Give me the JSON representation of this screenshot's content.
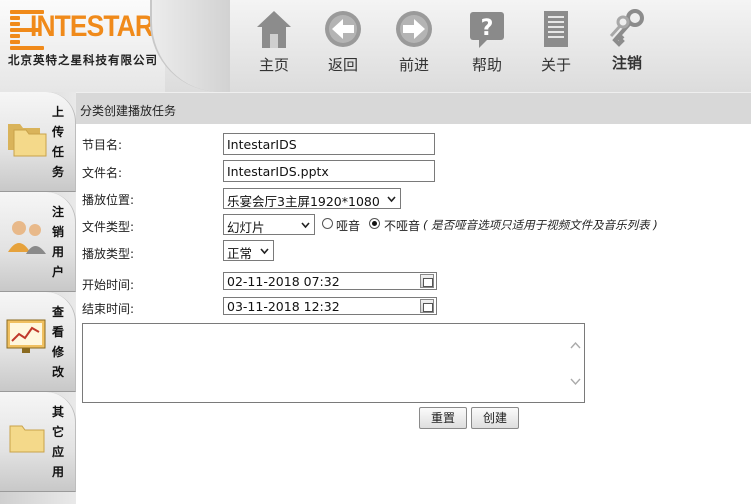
{
  "header": {
    "logo_text": "INTESTAR",
    "logo_subtitle": "北京英特之星科技有限公司",
    "nav": [
      {
        "label": "主页",
        "icon": "home-icon"
      },
      {
        "label": "返回",
        "icon": "back-arrow-icon"
      },
      {
        "label": "前进",
        "icon": "forward-arrow-icon"
      },
      {
        "label": "帮助",
        "icon": "help-icon"
      },
      {
        "label": "关于",
        "icon": "document-icon"
      },
      {
        "label": "注销",
        "icon": "keys-icon"
      }
    ]
  },
  "sidebar": {
    "items": [
      {
        "label": "上传任务",
        "icon": "folders-icon"
      },
      {
        "label": "注销用户",
        "icon": "users-icon"
      },
      {
        "label": "查看修改",
        "icon": "monitor-chart-icon"
      },
      {
        "label": "其它应用",
        "icon": "folder-icon"
      }
    ]
  },
  "breadcrumb": "分类创建播放任务",
  "form": {
    "program_name_label": "节目名:",
    "program_name_value": "IntestarIDS",
    "file_name_label": "文件名:",
    "file_name_value": "IntestarIDS.pptx",
    "location_label": "播放位置:",
    "location_value": "乐宴会厅3主屏1920*1080",
    "file_type_label": "文件类型:",
    "file_type_value": "幻灯片",
    "mute_option": "哑音",
    "unmute_option": "不哑音",
    "mute_selected": "不哑音",
    "mute_note": "( 是否哑音选项只适用于视频文件及音乐列表 )",
    "play_type_label": "播放类型:",
    "play_type_value": "正常",
    "start_time_label": "开始时间:",
    "start_time_value": "02-11-2018 07:32",
    "end_time_label": "结束时间:",
    "end_time_value": "03-11-2018 12:32",
    "textarea_value": ""
  },
  "buttons": {
    "reset": "重置",
    "create": "创建"
  },
  "colors": {
    "brand_orange": "#f08a1a",
    "header_gray": "#dcdcdc",
    "breadcrumb_bar": "#d8d8d8"
  }
}
